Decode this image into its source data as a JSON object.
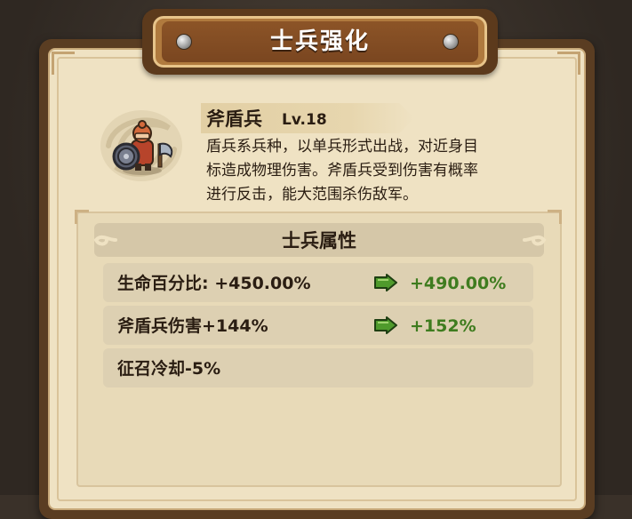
{
  "dialog": {
    "title": "士兵强化"
  },
  "unit": {
    "name": "斧盾兵",
    "level": "Lv.18",
    "description_lines": [
      "盾兵系兵种，以单兵形式出战，对近身目",
      "标造成物理伤害。斧盾兵受到伤害有概率",
      "进行反击，能大范围杀伤敌军。"
    ],
    "icon": "axe-shield-soldier-icon"
  },
  "attributes": {
    "header": "士兵属性",
    "rows": [
      {
        "label": "生命百分比: +450.00%",
        "upgraded": "+490.00%",
        "icon": "green-arrow-icon"
      },
      {
        "label": "斧盾兵伤害+144%",
        "upgraded": "+152%",
        "icon": "green-arrow-icon"
      },
      {
        "label": "征召冷却-5%"
      }
    ]
  },
  "colors": {
    "panel_bg": "#efe2c3",
    "title_bar": "#7a4620",
    "upgrade_green": "#3f7c1f",
    "text_dark": "#2a1d12"
  }
}
